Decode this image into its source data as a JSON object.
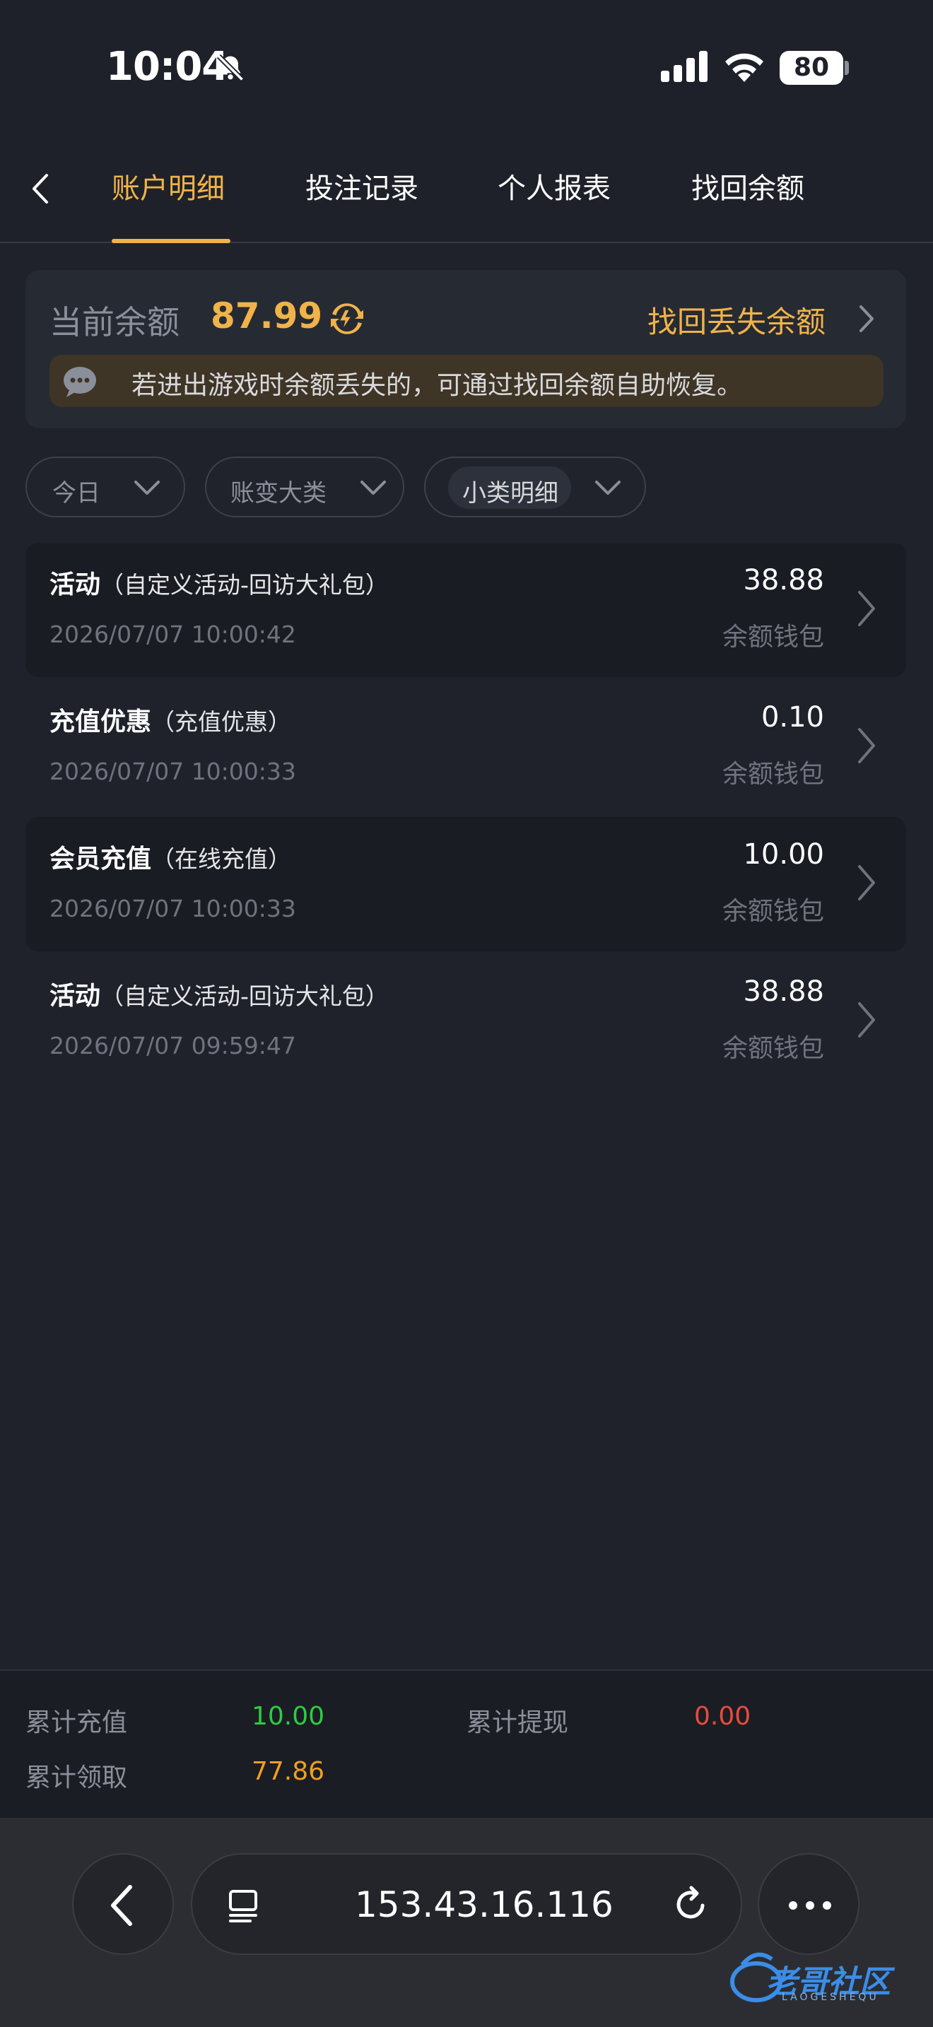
{
  "status_bar": {
    "time": "10:04",
    "battery": "80"
  },
  "nav": {
    "tabs": [
      {
        "label": "账户明细",
        "active": true
      },
      {
        "label": "投注记录",
        "active": false
      },
      {
        "label": "个人报表",
        "active": false
      },
      {
        "label": "找回余额",
        "active": false
      }
    ]
  },
  "balance": {
    "label": "当前余额",
    "value": "87.99",
    "recover_link": "找回丢失余额",
    "notice": "若进出游戏时余额丢失的，可通过找回余额自助恢复。"
  },
  "filters": [
    {
      "label": "今日"
    },
    {
      "label": "账变大类"
    },
    {
      "label": "小类明细"
    }
  ],
  "records": [
    {
      "title": "活动",
      "subtitle": "（自定义活动-回访大礼包）",
      "time": "2026/07/07 10:00:42",
      "amount": "38.88",
      "wallet": "余额钱包"
    },
    {
      "title": "充值优惠",
      "subtitle": "（充值优惠）",
      "time": "2026/07/07 10:00:33",
      "amount": "0.10",
      "wallet": "余额钱包"
    },
    {
      "title": "会员充值",
      "subtitle": "（在线充值）",
      "time": "2026/07/07 10:00:33",
      "amount": "10.00",
      "wallet": "余额钱包"
    },
    {
      "title": "活动",
      "subtitle": "（自定义活动-回访大礼包）",
      "time": "2026/07/07 09:59:47",
      "amount": "38.88",
      "wallet": "余额钱包"
    }
  ],
  "summary": {
    "total_deposit_label": "累计充值",
    "total_deposit_value": "10.00",
    "total_withdraw_label": "累计提现",
    "total_withdraw_value": "0.00",
    "total_claimed_label": "累计领取",
    "total_claimed_value": "77.86"
  },
  "browser": {
    "url": "153.43.16.116"
  },
  "watermark": {
    "text": "老哥社区",
    "sub": "LAOGESHEQU"
  },
  "colors": {
    "accent": "#f0b34a",
    "deposit_green": "#2ecc40",
    "withdraw_red": "#e74c3c",
    "claimed_orange": "#f0a020",
    "background": "#1f222b"
  },
  "icons": {
    "bell": "bell-slash-icon",
    "signal": "cellular-signal-icon",
    "wifi": "wifi-icon",
    "back": "chevron-left-icon",
    "refresh": "refresh-icon",
    "notice": "chat-bubble-icon",
    "row_chevron": "chevron-right-icon",
    "more": "more-dots-icon",
    "tabs": "tabs-icon",
    "reload": "reload-icon"
  }
}
